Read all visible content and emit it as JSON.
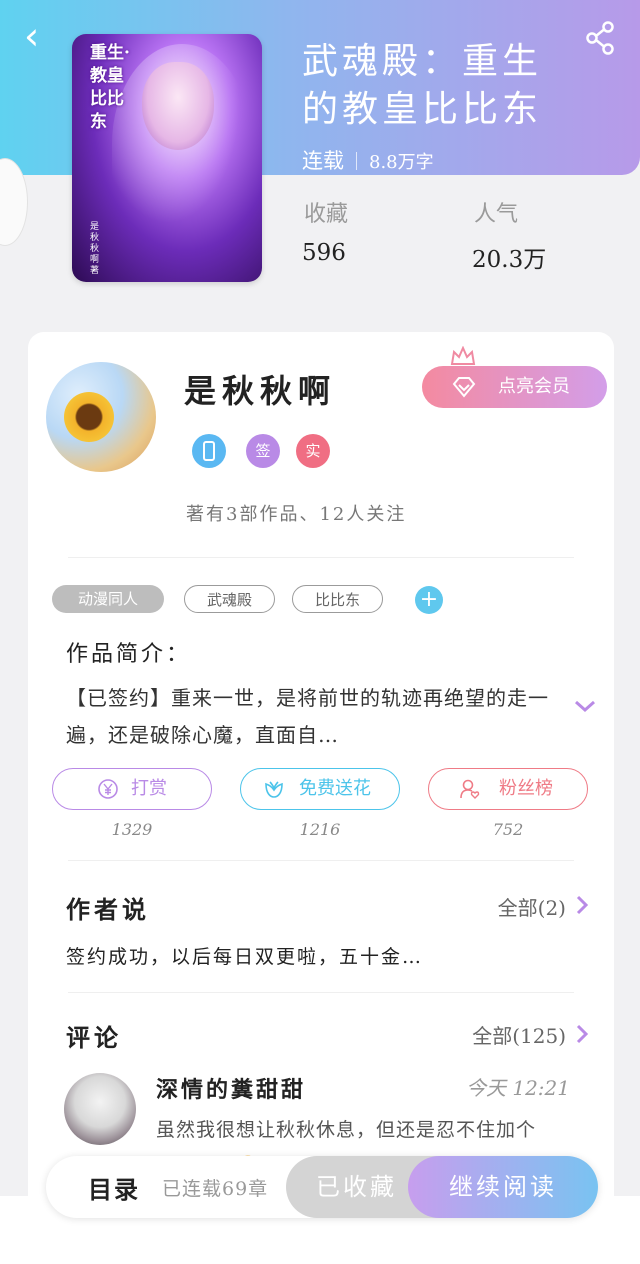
{
  "header": {
    "back_icon": "chevron-left-icon",
    "share_icon": "share-icon"
  },
  "book": {
    "title": "武魂殿：重生的教皇比比东",
    "status": "连载",
    "words": "8.8万字",
    "cover": {
      "title_text": "重生·教皇比比东",
      "author_text": "是秋秋啊 著"
    }
  },
  "stats": {
    "favorites_label": "收藏",
    "favorites_value": "596",
    "popularity_label": "人气",
    "popularity_value": "20.3万"
  },
  "author": {
    "name": "是秋秋啊",
    "vip_label": "点亮会员",
    "badges": [
      {
        "name": "phone-badge",
        "text": "",
        "color": "#5ab8f2"
      },
      {
        "name": "signed-badge",
        "text": "签",
        "color": "#b98ae6"
      },
      {
        "name": "real-badge",
        "text": "实",
        "color": "#f06e83"
      }
    ],
    "summary": "著有3部作品、12人关注"
  },
  "tags": [
    "动漫同人",
    "武魂殿",
    "比比东"
  ],
  "intro": {
    "heading": "作品简介：",
    "text": "【已签约】重来一世，是将前世的轨迹再绝望的走一遍，还是破除心魔，直面自…"
  },
  "actions": [
    {
      "label": "打赏",
      "count": "1329",
      "icon": "yen-coin-icon",
      "color": "#b98ae6"
    },
    {
      "label": "免费送花",
      "count": "1216",
      "icon": "flower-icon",
      "color": "#4cc4ea"
    },
    {
      "label": "粉丝榜",
      "count": "752",
      "icon": "fan-heart-icon",
      "color": "#ef7b86"
    }
  ],
  "author_says": {
    "heading": "作者说",
    "more": "全部(2)",
    "text": "签约成功，以后每日双更啦，五十金…"
  },
  "comments": {
    "heading": "评论",
    "more": "全部(125)",
    "first": {
      "user": "深情的糞甜甜",
      "time": "今天 12:21",
      "text": "虽然我很想让秋秋休息，但还是忍不住加个了，更了😢"
    }
  },
  "bottom": {
    "toc": "目录",
    "toc_sub": "已连载69章",
    "favorited": "已收藏",
    "read": "继续阅读"
  },
  "colors": {
    "header_gradient": [
      "#5fd2f0",
      "#b79ae9"
    ],
    "accent_purple": "#b98ae6",
    "accent_blue": "#4cc4ea",
    "accent_pink": "#ef7b86"
  }
}
